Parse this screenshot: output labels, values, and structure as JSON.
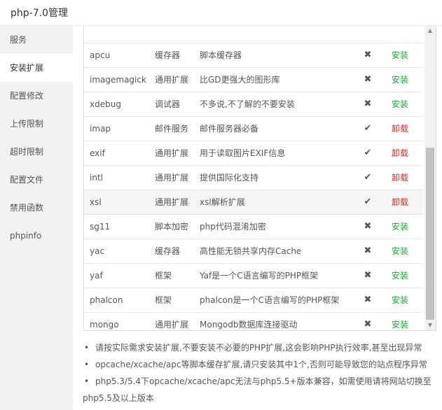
{
  "window": {
    "title": "php-7.0管理"
  },
  "sidebar": {
    "items": [
      {
        "label": "服务"
      },
      {
        "label": "安装扩展"
      },
      {
        "label": "配置修改"
      },
      {
        "label": "上传限制"
      },
      {
        "label": "超时限制"
      },
      {
        "label": "配置文件"
      },
      {
        "label": "禁用函数"
      },
      {
        "label": "phpinfo"
      }
    ],
    "active": "安装扩展"
  },
  "extensions": [
    {
      "name": "apcu",
      "type": "缓存器",
      "desc": "脚本缓存器",
      "status": "✖",
      "action": "安装"
    },
    {
      "name": "imagemagick",
      "type": "通用扩展",
      "desc": "比GD更强大的图形库",
      "status": "✖",
      "action": "安装"
    },
    {
      "name": "xdebug",
      "type": "调试器",
      "desc": "不多说,不了解的不要安装",
      "status": "✖",
      "action": "安装"
    },
    {
      "name": "imap",
      "type": "邮件服务",
      "desc": "邮件服务器必备",
      "status": "✔",
      "action": "卸载"
    },
    {
      "name": "exif",
      "type": "通用扩展",
      "desc": "用于读取图片EXIF信息",
      "status": "✔",
      "action": "卸载"
    },
    {
      "name": "intl",
      "type": "通用扩展",
      "desc": "提供国际化支持",
      "status": "✔",
      "action": "卸载"
    },
    {
      "name": "xsl",
      "type": "通用扩展",
      "desc": "xsl解析扩展",
      "status": "✔",
      "action": "卸载"
    },
    {
      "name": "sg11",
      "type": "脚本加密",
      "desc": "php代码混淆加密",
      "status": "✖",
      "action": "安装"
    },
    {
      "name": "yac",
      "type": "缓存器",
      "desc": "高性能无锁共享内存Cache",
      "status": "✖",
      "action": "安装"
    },
    {
      "name": "yaf",
      "type": "框架",
      "desc": "Yaf是一个C语言编写的PHP框架",
      "status": "✖",
      "action": "安装"
    },
    {
      "name": "phalcon",
      "type": "框架",
      "desc": "phalcon是一个C语言编写的PHP框架",
      "status": "✖",
      "action": "安装"
    },
    {
      "name": "mongo",
      "type": "通用扩展",
      "desc": "Mongodb数据库连接驱动",
      "status": "✖",
      "action": "安装"
    }
  ],
  "notes": [
    "请按实际需求安装扩展,不要安装不必要的PHP扩展,这会影响PHP执行效率,甚至出现异常",
    "opcache/xcache/apc等脚本缓存扩展,请只安装其中1个,否则可能导致您的站点程序异常",
    "php5.3/5.4下opcache/xcache/apc无法与php5.5+版本兼容，如需使用请将网站切换至php5.5及以上版本"
  ],
  "colors": {
    "install": "#20a53a",
    "uninstall": "#c9302c",
    "sidebar_bg": "#f2f2f2"
  }
}
